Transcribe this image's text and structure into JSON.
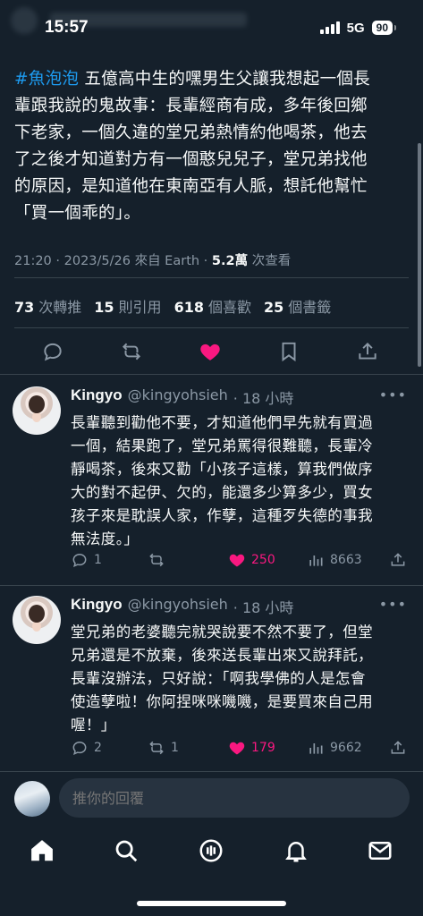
{
  "status_bar": {
    "time": "15:57",
    "network": "5G",
    "battery": "90"
  },
  "tweet": {
    "hashtag": "#魚泡泡",
    "lines": [
      " 五億高中生的嘿男生父讓我想起一個長",
      "輩跟我說的鬼故事：長輩經商有成，多年後回鄉",
      "下老家，一個久違的堂兄弟熱情約他喝茶，他去",
      "了之後才知道對方有一個憨兒兒子，堂兄弟找他",
      "的原因，是知道他在東南亞有人脈，想託他幫忙",
      "「買一個乖的」。"
    ],
    "meta_prefix": "21:20 · 2023/5/26 來自 Earth · ",
    "views_count": "5.2萬",
    "views_label": " 次查看",
    "stats": [
      {
        "count": "73",
        "label": "次轉推"
      },
      {
        "count": "15",
        "label": "則引用"
      },
      {
        "count": "618",
        "label": "個喜歡"
      },
      {
        "count": "25",
        "label": "個書籤"
      }
    ]
  },
  "replies": [
    {
      "name": "Kingyo",
      "handle": "@kingyohsieh",
      "time": "· 18 小時",
      "lines": [
        "長輩聽到勸他不要，才知道他們早先就有買過",
        "一個，結果跑了，堂兄弟罵得很難聽，長輩冷",
        "靜喝茶，後來又勸「小孩子這樣，算我們做序",
        "大的對不起伊、欠的，能還多少算多少，買女",
        "孩子來是耽誤人家，作孽，這種歹失德的事我",
        "無法度。」"
      ],
      "replies": "1",
      "retweets": "",
      "likes": "250",
      "views": "8663"
    },
    {
      "name": "Kingyo",
      "handle": "@kingyohsieh",
      "time": "· 18 小時",
      "lines": [
        "堂兄弟的老婆聽完就哭說要不然不要了，但堂",
        "兄弟還是不放棄，後來送長輩出來又說拜託，",
        "長輩沒辦法，只好說：「啊我學佛的人是怎會",
        "使造孽啦！你阿捏咪咪嘰嘰，是要買來自己用",
        "喔！」"
      ],
      "replies": "2",
      "retweets": "1",
      "likes": "179",
      "views": "9662"
    }
  ],
  "compose": {
    "placeholder": "推你的回覆"
  },
  "colors": {
    "background": "#15202b",
    "accent": "#1d9bf0",
    "like": "#f91880",
    "muted": "#8b98a5"
  },
  "icons": {
    "main_actions": [
      "reply-icon",
      "retweet-icon",
      "like-icon",
      "bookmark-icon",
      "share-icon"
    ],
    "tabbar": [
      "home-icon",
      "search-icon",
      "spaces-icon",
      "notifications-icon",
      "messages-icon"
    ]
  }
}
